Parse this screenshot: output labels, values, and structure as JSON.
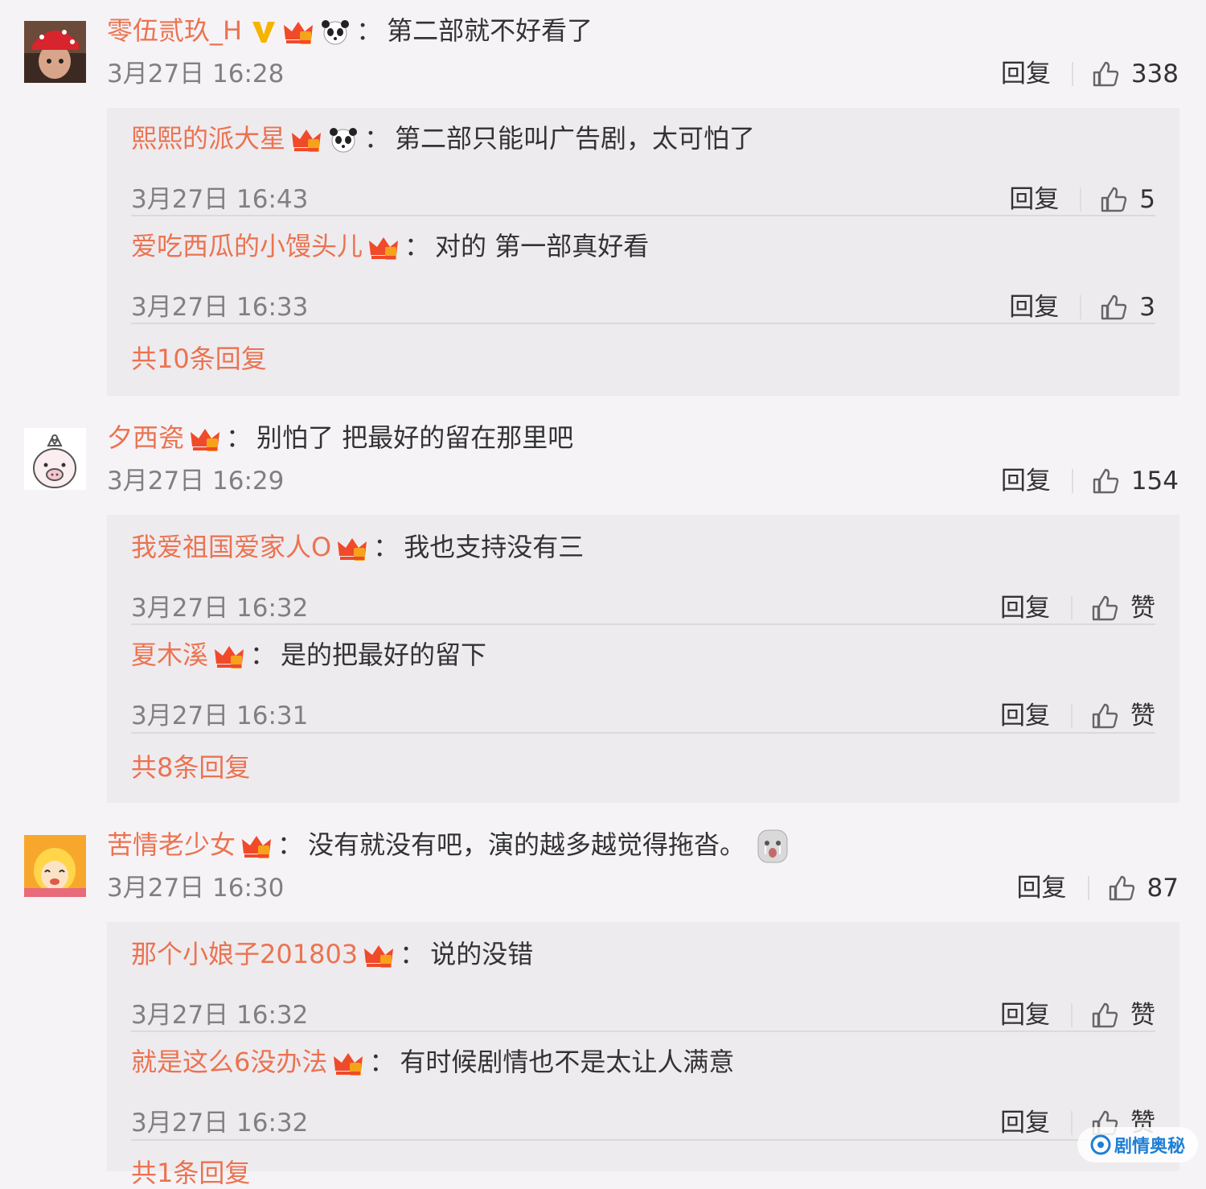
{
  "actions": {
    "reply_label": "回复",
    "like_label": "赞"
  },
  "threads": [
    {
      "user": "零伍贰玖_H",
      "verified": true,
      "colon": "：",
      "text": "第二部就不好看了",
      "time": "3月27日 16:28",
      "likes": "338",
      "avatar_icon": "red-hat-person-avatar",
      "replies": [
        {
          "user": "熙熙的派大星",
          "colon": "：",
          "text": "第二部只能叫广告剧，太可怕了",
          "time": "3月27日 16:43",
          "likes": "5"
        },
        {
          "user": "爱吃西瓜的小馒头儿",
          "colon": "：",
          "text": "对的 第一部真好看",
          "time": "3月27日 16:33",
          "likes": "3"
        }
      ],
      "more": "共10条回复"
    },
    {
      "user": "夕西瓷",
      "colon": "：",
      "text": "别怕了 把最好的留在那里吧",
      "time": "3月27日 16:29",
      "likes": "154",
      "avatar_icon": "cartoon-pig-avatar",
      "replies": [
        {
          "user": "我爱祖国爱家人O",
          "colon": "：",
          "text": "我也支持没有三",
          "time": "3月27日 16:32",
          "likes": "赞"
        },
        {
          "user": "夏木溪",
          "colon": "：",
          "text": "是的把最好的留下",
          "time": "3月27日 16:31",
          "likes": "赞"
        }
      ],
      "more": "共8条回复"
    },
    {
      "user": "苦情老少女",
      "colon": "：",
      "text": "没有就没有吧，演的越多越觉得拖沓。",
      "time": "3月27日 16:30",
      "likes": "87",
      "avatar_icon": "cartoon-girl-avatar",
      "replies": [
        {
          "user": "那个小娘子201803",
          "colon": "：",
          "text": "说的没错",
          "time": "3月27日 16:32",
          "likes": "赞"
        },
        {
          "user": "就是这么6没办法",
          "colon": "：",
          "text": "有时候剧情也不是太让人满意",
          "time": "3月27日 16:32",
          "likes": "赞"
        }
      ],
      "more": "共1条回复"
    }
  ],
  "watermark": "剧情奥秘",
  "colors": {
    "username": "#eb7350",
    "time": "#808080",
    "reply_bg": "#eeebef",
    "page_bg": "#f6f3f7"
  }
}
